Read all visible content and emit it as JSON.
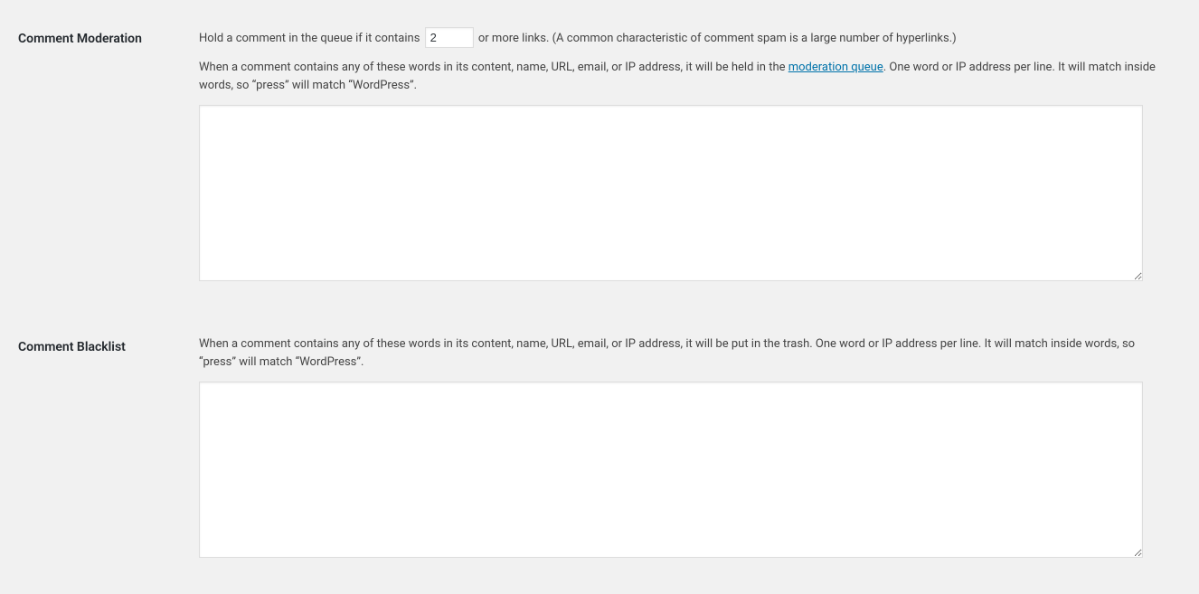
{
  "moderation": {
    "heading": "Comment Moderation",
    "line1_before": "Hold a comment in the queue if it contains ",
    "links_value": "2",
    "line1_after": " or more links. (A common characteristic of comment spam is a large number of hyperlinks.)",
    "desc_before": "When a comment contains any of these words in its content, name, URL, email, or IP address, it will be held in the ",
    "desc_link": "moderation queue",
    "desc_after": ". One word or IP address per line. It will match inside words, so “press” will match “WordPress”.",
    "textarea_value": ""
  },
  "blacklist": {
    "heading": "Comment Blacklist",
    "desc": "When a comment contains any of these words in its content, name, URL, email, or IP address, it will be put in the trash. One word or IP address per line. It will match inside words, so “press” will match “WordPress”.",
    "textarea_value": ""
  }
}
